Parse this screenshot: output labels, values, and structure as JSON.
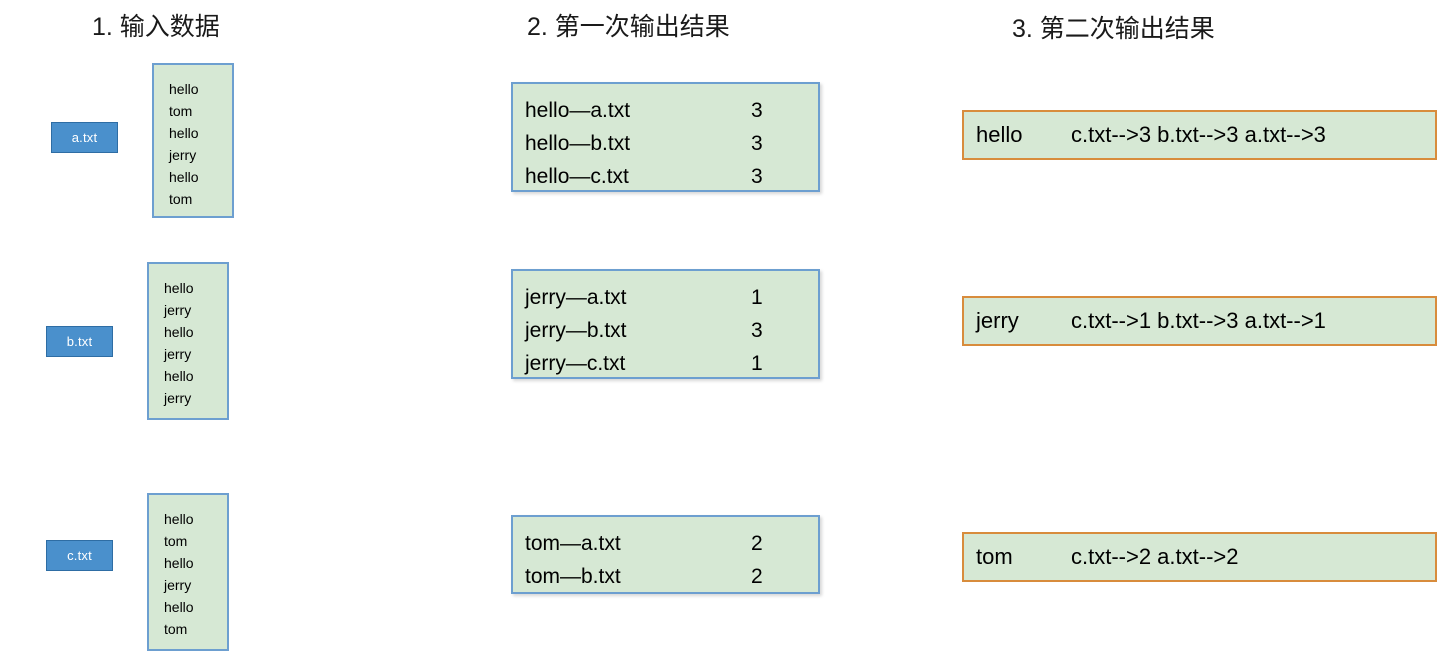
{
  "columns": {
    "input": {
      "title": "1. 输入数据"
    },
    "first_output": {
      "title": "2. 第一次输出结果"
    },
    "second_output": {
      "title": "3. 第二次输出结果"
    }
  },
  "input_files": [
    {
      "badge": "a.txt",
      "lines": [
        "hello",
        "tom",
        "hello",
        "jerry",
        "hello",
        "tom"
      ]
    },
    {
      "badge": "b.txt",
      "lines": [
        "hello",
        "jerry",
        "hello",
        "jerry",
        "hello",
        "jerry"
      ]
    },
    {
      "badge": "c.txt",
      "lines": [
        "hello",
        "tom",
        "hello",
        "jerry",
        "hello",
        "tom"
      ]
    }
  ],
  "first_output": [
    {
      "group": "hello",
      "rows": [
        {
          "key": "hello—a.txt",
          "count": "3"
        },
        {
          "key": "hello—b.txt",
          "count": "3"
        },
        {
          "key": "hello—c.txt",
          "count": "3"
        }
      ]
    },
    {
      "group": "jerry",
      "rows": [
        {
          "key": "jerry—a.txt",
          "count": "1"
        },
        {
          "key": "jerry—b.txt",
          "count": "3"
        },
        {
          "key": "jerry—c.txt",
          "count": "1"
        }
      ]
    },
    {
      "group": "tom",
      "rows": [
        {
          "key": "tom—a.txt",
          "count": "2"
        },
        {
          "key": "tom—b.txt",
          "count": "2"
        }
      ]
    }
  ],
  "second_output": [
    {
      "word": "hello",
      "detail": "c.txt-->3 b.txt-->3 a.txt-->3"
    },
    {
      "word": "jerry",
      "detail": "c.txt-->1 b.txt-->3 a.txt-->1"
    },
    {
      "word": "tom",
      "detail": "c.txt-->2 a.txt-->2"
    }
  ],
  "colors": {
    "box_fill": "#d6e8d4",
    "box_border_blue": "#6d9fd0",
    "box_border_orange": "#d88c3c",
    "badge_fill": "#4a90cc",
    "badge_border": "#2e6da4",
    "badge_text": "#ffffff",
    "background": "#ffffff",
    "text": "#000000"
  }
}
